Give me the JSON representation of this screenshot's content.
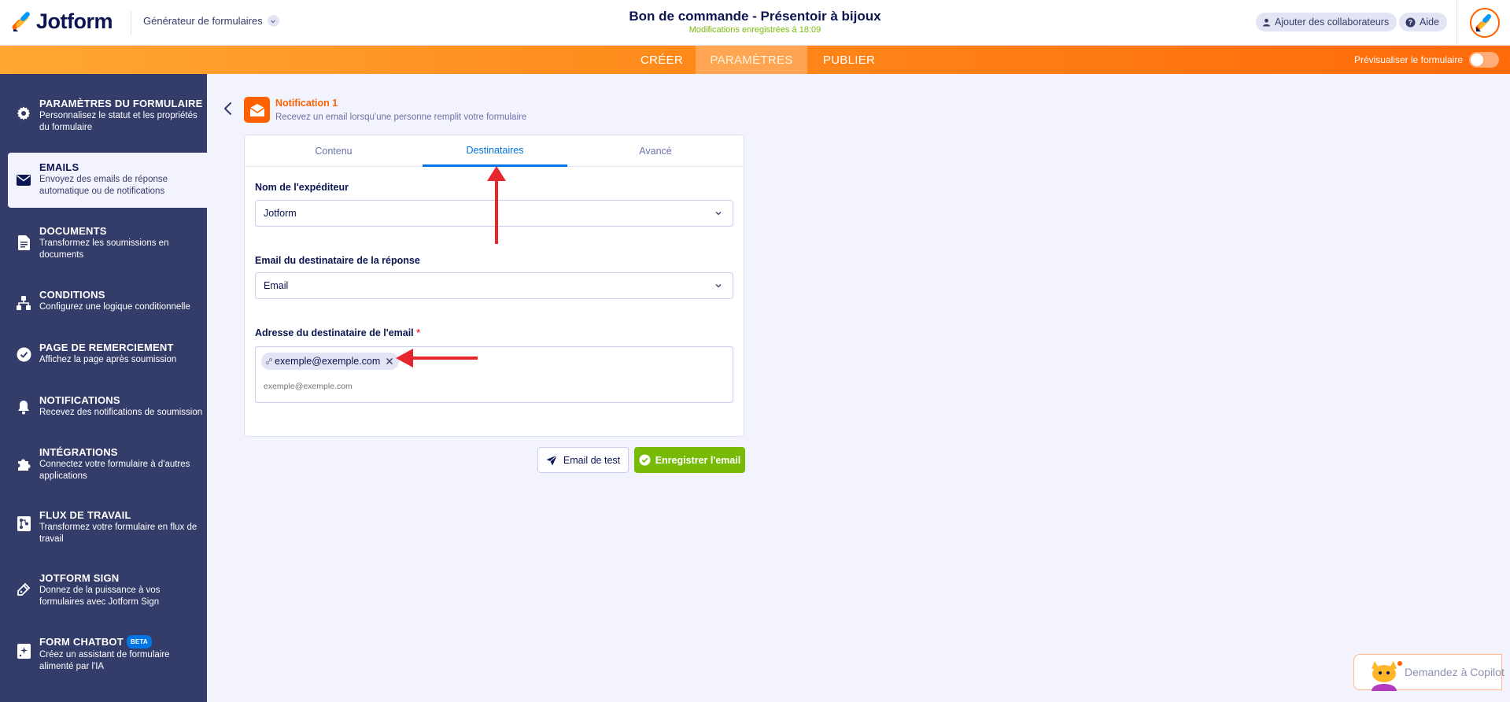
{
  "header": {
    "logo_text": "Jotform",
    "builder_label": "Générateur de formulaires",
    "form_title": "Bon de commande - Présentoir à bijoux",
    "saved_status": "Modifications enregistrées à 18:09",
    "collab_label": "Ajouter des collaborateurs",
    "help_label": "Aide"
  },
  "nav": {
    "tabs": [
      {
        "label": "CRÉER"
      },
      {
        "label": "PARAMÈTRES"
      },
      {
        "label": "PUBLIER"
      }
    ],
    "active_tab": "PARAMÈTRES",
    "preview_label": "Prévisualiser le formulaire"
  },
  "sidebar": {
    "items": [
      {
        "title": "PARAMÈTRES DU FORMULAIRE",
        "desc": "Personnalisez le statut et les propriétés du formulaire",
        "icon": "gear-icon"
      },
      {
        "title": "EMAILS",
        "desc": "Envoyez des emails de réponse automatique ou de notifications",
        "icon": "envelope-icon"
      },
      {
        "title": "DOCUMENTS",
        "desc": "Transformez les soumissions en documents",
        "icon": "document-icon"
      },
      {
        "title": "CONDITIONS",
        "desc": "Configurez une logique conditionnelle",
        "icon": "sitemap-icon"
      },
      {
        "title": "PAGE DE REMERCIEMENT",
        "desc": "Affichez la page après soumission",
        "icon": "check-circle-icon"
      },
      {
        "title": "NOTIFICATIONS",
        "desc": "Recevez des notifications de soumission",
        "icon": "bell-icon"
      },
      {
        "title": "INTÉGRATIONS",
        "desc": "Connectez votre formulaire à d'autres applications",
        "icon": "puzzle-icon"
      },
      {
        "title": "FLUX DE TRAVAIL",
        "desc": "Transformez votre formulaire en flux de travail",
        "icon": "workflow-icon"
      },
      {
        "title": "JOTFORM SIGN",
        "desc": "Donnez de la puissance à vos formulaires avec Jotform Sign",
        "icon": "pen-icon"
      },
      {
        "title": "FORM CHATBOT",
        "badge": "BETA",
        "desc": "Créez un assistant de formulaire alimenté par l'IA",
        "icon": "chatbot-icon"
      }
    ],
    "active_index": 1
  },
  "notification": {
    "title": "Notification 1",
    "desc": "Recevez un email lorsqu'une personne remplit votre formulaire"
  },
  "card": {
    "tabs": [
      {
        "label": "Contenu"
      },
      {
        "label": "Destinataires"
      },
      {
        "label": "Avancé"
      }
    ],
    "active_tab": "Destinataires",
    "sender_label": "Nom de l'expéditeur",
    "sender_value": "Jotform",
    "reply_label": "Email du destinataire de la réponse",
    "reply_value": "Email",
    "recipient_label": "Adresse du destinataire de l'email",
    "required_mark": "*",
    "recipient_tag": "exemple@exemple.com",
    "recipient_placeholder": "exemple@exemple.com"
  },
  "actions": {
    "test_label": "Email de test",
    "save_label": "Enregistrer l'email"
  },
  "copilot": {
    "label": "Demandez à Copilot"
  },
  "colors": {
    "brand_orange": "#ff6100",
    "sidebar_bg": "#343c6a",
    "active_blue": "#0075e3",
    "save_green": "#78bb07",
    "annotation_red": "#e5262d"
  }
}
